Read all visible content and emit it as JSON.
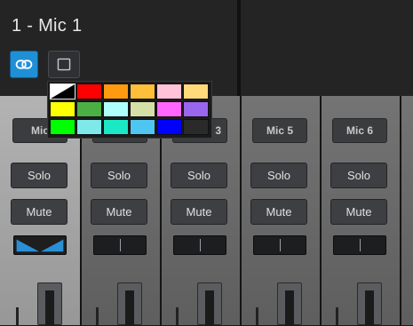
{
  "header": {
    "track_title": "1 - Mic 1",
    "link_icon": "link-chain-icon",
    "square_icon": "square-outline-icon",
    "accent": "#1f8fd6"
  },
  "color_palette": {
    "swatches": [
      {
        "name": "none",
        "color": "diagonal-white-black"
      },
      {
        "name": "red",
        "color": "#ff0000"
      },
      {
        "name": "orange",
        "color": "#ff9a10"
      },
      {
        "name": "amber",
        "color": "#ffbf3a"
      },
      {
        "name": "pink",
        "color": "#ffc2d8"
      },
      {
        "name": "sand",
        "color": "#ffd97a"
      },
      {
        "name": "yellow",
        "color": "#ffff00"
      },
      {
        "name": "green",
        "color": "#4caf46"
      },
      {
        "name": "light-cyan",
        "color": "#b0ffff"
      },
      {
        "name": "khaki",
        "color": "#d6e0a6"
      },
      {
        "name": "magenta",
        "color": "#ff66ff"
      },
      {
        "name": "purple",
        "color": "#9966ee"
      },
      {
        "name": "bright-green",
        "color": "#00ff00"
      },
      {
        "name": "aqua",
        "color": "#7fe8e8"
      },
      {
        "name": "turquoise",
        "color": "#1be8c4"
      },
      {
        "name": "sky-blue",
        "color": "#4fc6f2"
      },
      {
        "name": "blue",
        "color": "#0000ff"
      },
      {
        "name": "dark",
        "color": "#2a2a2a"
      }
    ]
  },
  "strips": [
    {
      "name": "Mic",
      "solo": "Solo",
      "mute": "Mute",
      "active": true
    },
    {
      "name": "",
      "solo": "Solo",
      "mute": "Mute",
      "active": false
    },
    {
      "name": "3",
      "solo": "Solo",
      "mute": "Mute",
      "active": false
    },
    {
      "name": "Mic 5",
      "solo": "Solo",
      "mute": "Mute",
      "active": false
    },
    {
      "name": "Mic 6",
      "solo": "Solo",
      "mute": "Mute",
      "active": false
    }
  ]
}
